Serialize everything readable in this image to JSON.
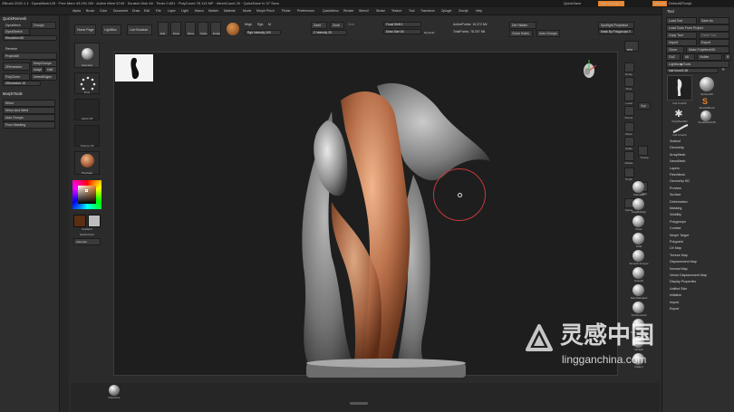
{
  "titlebar": {
    "text": "ZBrush 2020.1.1  ·  DynaMesh128  ·  Free Mem 43.091 GB  ·  Active Mem 5745  ·  Scratch Disk 48  ·  Timer 0.691  ·  PolyCount 78.113 MP  ·  MeshCount 20  ·  QuickSave In 37 Secs",
    "quicksave": "QuickSave",
    "seethrough": "See-through 0",
    "menus": "Menus",
    "script": "DefaultZScript"
  },
  "menubar": [
    "Alpha",
    "Brush",
    "Color",
    "Document",
    "Draw",
    "Edit",
    "File",
    "Layer",
    "Light",
    "Macro",
    "Marker",
    "Material",
    "Movie",
    "Morph Pinch",
    "Picker",
    "Preferences",
    "QuickMenu",
    "Render",
    "Stencil",
    "Stroke",
    "Texture",
    "Tool",
    "Transform",
    "Zplugin",
    "Zscript",
    "Help"
  ],
  "leftpanel": {
    "header": "QuickRemesh",
    "dynamesh": "DynaMesh",
    "groups": "Groups",
    "dynasketch": "DynaSketch",
    "resolution": "Resolution 80",
    "remesh": "Remesh",
    "project_all": "ProjectAll",
    "zremesher": "ZRemesher",
    "keepgroups": "KeepGroups",
    "adapt": "Adapt",
    "half": "Half",
    "detect_edges": "DetectEdges",
    "polyclone": "PolyClone",
    "target_count": "ZRemesher 15",
    "morphtools_header": "MorphTools",
    "mirror": "Mirror",
    "mirror_weld": "Mirror And Weld",
    "auto_groups": "Auto Groups",
    "from_masking": "From Masking"
  },
  "shelf": {
    "home_page": "Home Page",
    "lightbox": "LightBox",
    "live_boolean": "Live Boolean",
    "edit": "Edit",
    "draw": "Draw",
    "move": "Move",
    "scale": "Scale",
    "rotate": "Rotate",
    "mrgb": "Mrgb",
    "rgb": "Rgb",
    "m": "M",
    "zadd": "Zadd",
    "zsub": "Zsub",
    "zcut": "Zcut",
    "rgb_intensity": "Rgb Intensity 100",
    "z_intensity": "Z Intensity 25",
    "focal_shift": "Focal Shift 0",
    "draw_size": "Draw Size 64",
    "dynamic": "Dynamic",
    "active_points": "ActivePoints: 15.372 Mil",
    "total_points": "TotalPoints: 78.257 Mil",
    "del_hidden": "Del Hidden",
    "close_holes": "Close Holes",
    "auto_groups": "Auto Groups",
    "spotlight_projection": "Spotlight Projection",
    "mask_polygroups": "Mask By Polygroups 0"
  },
  "leftshelf": {
    "standard": "Standard",
    "dots": "Dots",
    "alpha_off": "Alpha Off",
    "texture_off": "Texture Off",
    "polypaint": "PolySpat",
    "gradient": "Gradient",
    "switchcolor": "SwitchColor",
    "alternate": "Alternate"
  },
  "rightshelf": {
    "bpr": "BPR",
    "persp": "Persp",
    "floor": "Floor",
    "local": "Local",
    "xyz": "Xyz",
    "frame": "Frame",
    "move": "Move",
    "scale": "Scale",
    "rotate": "Rotate",
    "polyf": "PolyF",
    "transp": "Transp",
    "solo": "Solo",
    "xpose": "Xpose"
  },
  "brushes": [
    "Standard",
    "ClayBuildup",
    "Move",
    "Inflat",
    "Smooth Groups",
    "Smooth",
    "DamStandard",
    "TrimDynamic",
    "SmoothPeaks",
    "hPolish",
    "Flatten"
  ],
  "rightpanel": {
    "header": "Tool",
    "load_tool": "Load Tool",
    "save_as": "Save As",
    "load_from_project": "Load Tools From Project",
    "copy_tool": "Copy Tool",
    "paste_tool": "Paste Tool",
    "import": "Import",
    "export": "Export",
    "clone": "Clone",
    "make_polymesh": "Make PolyMesh3D",
    "goz": "GoZ",
    "all": "All",
    "visible": "Visible",
    "r": "R",
    "lightbox_tools": "Lightbox▶Tools",
    "current_tool": "hair brush2  48",
    "r_label": "R",
    "thumb1": "hair brush2",
    "thumb2": "Sphere3D",
    "thumb3": "SimpleBrush",
    "thumb4": "PolyMesh3D",
    "thumb5": "DynaMesh128",
    "thumb6": "hair brush3",
    "sections": [
      "Subtool",
      "Geometry",
      "ArrayMesh",
      "NanoMesh",
      "Layers",
      "FiberMesh",
      "Geometry HD",
      "Preview",
      "Surface",
      "Deformation",
      "Masking",
      "Visibility",
      "Polygroups",
      "Contact",
      "Morph Target",
      "Polypaint",
      "UV Map",
      "Texture Map",
      "Displacement Map",
      "Normal Map",
      "Vector Displacement Map",
      "Display Properties",
      "Unified Skin",
      "Initialize",
      "Import",
      "Export"
    ]
  },
  "bottom": {
    "clipcurve": "ClipCurve"
  },
  "watermark": {
    "cn": "灵感中国",
    "url": "lingganchina.com"
  },
  "colors": {
    "accent": "#e8832a",
    "panel": "#2e2e2e",
    "canvas": "#1e1e1e",
    "primary_color": "#5a2e12"
  }
}
